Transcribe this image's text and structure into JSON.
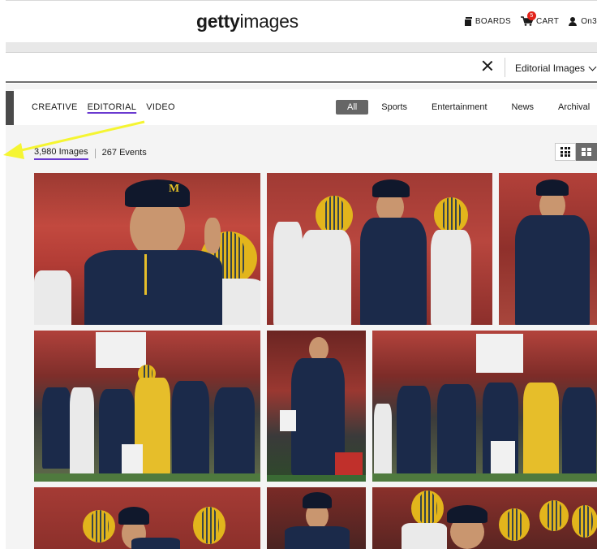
{
  "header": {
    "logo_bold": "getty",
    "logo_light": "images",
    "boards_label": "BOARDS",
    "cart_label": "CART",
    "cart_count": "5",
    "account_label": "On3"
  },
  "search": {
    "type_selected": "Editorial Images"
  },
  "asset_tabs": [
    "CREATIVE",
    "EDITORIAL",
    "VIDEO"
  ],
  "asset_tab_active": "EDITORIAL",
  "category_tabs": [
    "All",
    "Sports",
    "Entertainment",
    "News",
    "Archival"
  ],
  "category_tab_active": "All",
  "results": {
    "images_label": "3,980 Images",
    "events_label": "267 Events"
  },
  "view_modes": {
    "grid": "grid-icon",
    "mosaic": "mosaic-icon",
    "active": "mosaic"
  },
  "colors": {
    "accent_purple": "#6a3ad0",
    "cart_badge": "#e2231a",
    "annotation_arrow": "#f5f532",
    "michigan_navy": "#1b2a4a",
    "michigan_maize": "#e2b51c",
    "husker_red": "#b5262b"
  }
}
